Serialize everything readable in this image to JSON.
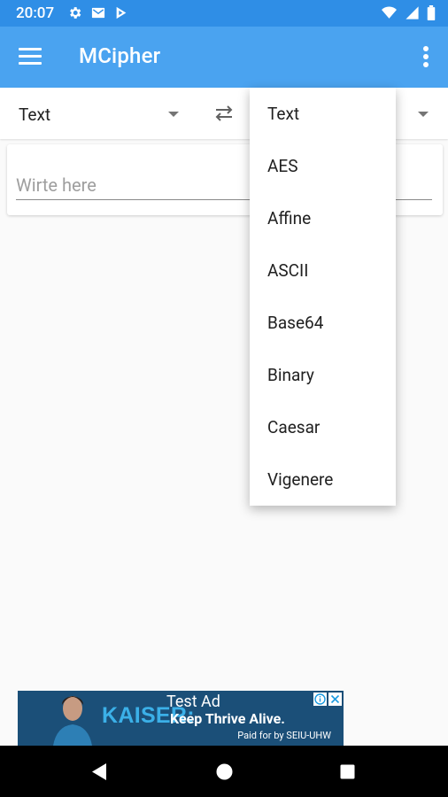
{
  "status_bar": {
    "time": "20:07"
  },
  "app_bar": {
    "title": "MCipher"
  },
  "selector": {
    "from_value": "Text"
  },
  "input": {
    "placeholder": "Wirte here"
  },
  "dropdown": {
    "options": [
      "Text",
      "AES",
      "Affine",
      "ASCII",
      "Base64",
      "Binary",
      "Caesar",
      "Vigenere"
    ]
  },
  "ad": {
    "label": "Test Ad",
    "brand": "KAISER:",
    "tagline": "Keep Thrive Alive.",
    "paid_by": "Paid for by  SEIU-UHW"
  },
  "colors": {
    "status_bar": "#2f8ee6",
    "app_bar": "#4aa3f0",
    "ad_bg": "#1b4f78",
    "ad_brand": "#3bb0e8"
  },
  "icons": [
    "settings-icon",
    "mail-icon",
    "play-store-icon",
    "wifi-icon",
    "signal-icon",
    "battery-icon",
    "menu-icon",
    "more-icon",
    "dropdown-caret-icon",
    "swap-icon",
    "ad-info-icon",
    "ad-close-icon",
    "nav-back-icon",
    "nav-home-icon",
    "nav-recents-icon"
  ]
}
